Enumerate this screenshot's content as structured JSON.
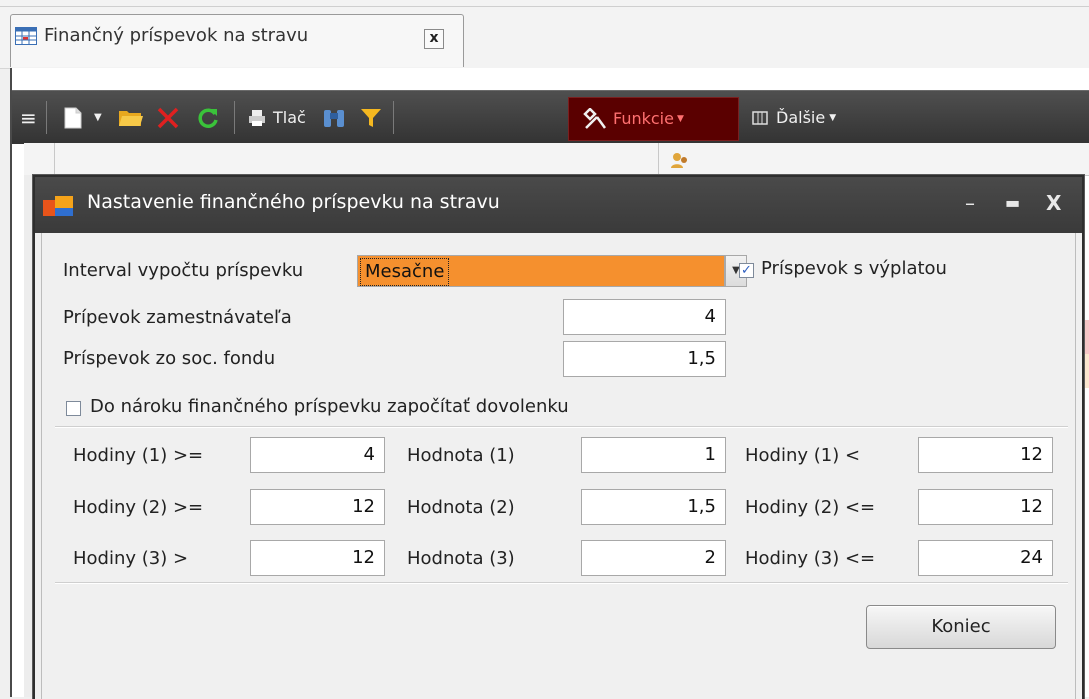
{
  "tab": {
    "title": "Finančný príspevok na stravu",
    "close": "x"
  },
  "toolbar": {
    "menu": "≡",
    "print": "Tlač",
    "functions": "Funkcie",
    "more": "Ďalšie"
  },
  "colors": {
    "toolbar_bg": "#3d3d3d",
    "funkcie_bg": "#5a0000",
    "combo_selected": "#f5902e"
  },
  "dialog": {
    "title": "Nastavenie finančného príspevku na stravu",
    "buttons": {
      "minimize": "–",
      "maximize": "▬",
      "close": "X"
    },
    "interval_label": "Interval vypočtu príspevku",
    "interval_value": "Mesačne",
    "with_payout_label": "Príspevok s výplatou",
    "with_payout_checked": true,
    "employer_label": "Prípevok zamestnávateľa",
    "employer_value": "4",
    "social_fund_label": "Príspevok zo soc. fondu",
    "social_fund_value": "1,5",
    "vacation_label": "Do nároku finančného príspevku započítať dovolenku",
    "vacation_checked": false,
    "rows": [
      {
        "h1_label": "Hodiny (1) >=",
        "h1_value": "4",
        "v_label": "Hodnota (1)",
        "v_value": "1",
        "h2_label": "Hodiny (1) <",
        "h2_value": "12"
      },
      {
        "h1_label": "Hodiny (2) >=",
        "h1_value": "12",
        "v_label": "Hodnota (2)",
        "v_value": "1,5",
        "h2_label": "Hodiny (2) <=",
        "h2_value": "12"
      },
      {
        "h1_label": "Hodiny (3) >",
        "h1_value": "12",
        "v_label": "Hodnota (3)",
        "v_value": "2",
        "h2_label": "Hodiny (3) <=",
        "h2_value": "24"
      }
    ],
    "close_button": "Koniec"
  }
}
